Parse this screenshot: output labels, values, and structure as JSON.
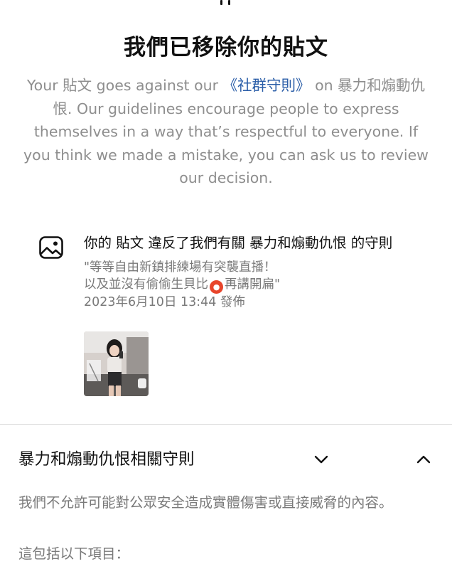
{
  "header": {
    "title": "我們已移除你的貼文"
  },
  "description": {
    "part1": "Your 貼文 goes against our ",
    "link": "《社群守則》",
    "part2": " on 暴力和煽動仇恨. Our guidelines encourage people to express themselves in a way that’s respectful to everyone. If you think we made a mistake, you can ask us to review our decision."
  },
  "notice": {
    "icon": "image-icon",
    "title": "你的 貼文 違反了我們有關 暴力和煽動仇恨 的守則",
    "quote_line1": "\"等等自由新鎮排練場有突襲直播！",
    "quote_line2_before": "以及並沒有偷偷生貝比",
    "quote_emoji": "angry-face-emoji",
    "quote_line2_after": "再講開扁\"",
    "date": "2023年6月10日 13:44 發佈"
  },
  "guidelines": {
    "title": "暴力和煽動仇恨相關守則",
    "expand_icon": "chevron-down-icon",
    "collapse_icon": "chevron-up-icon",
    "text": "我們不允許可能對公眾安全造成實體傷害或直接威脅的內容。",
    "subtext": "這包括以下項目："
  }
}
